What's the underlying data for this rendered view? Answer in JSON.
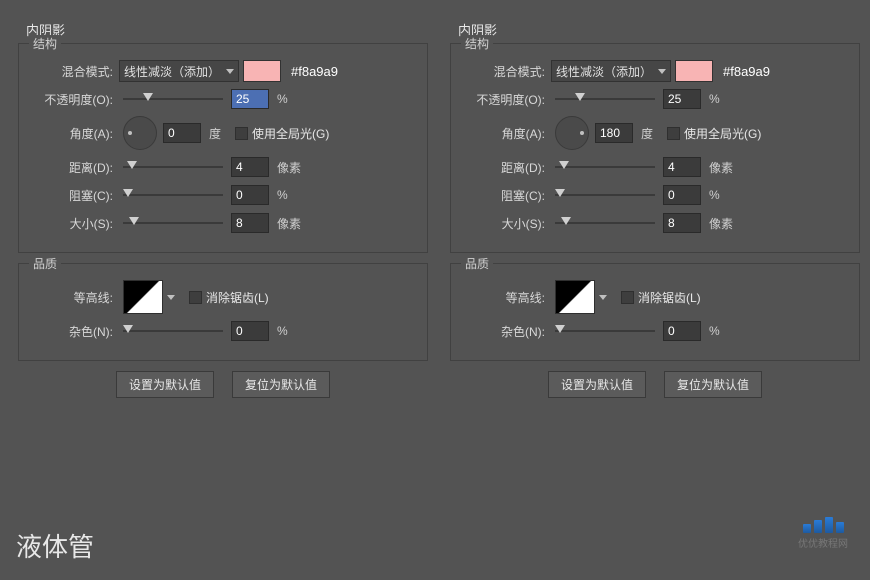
{
  "panels": [
    {
      "title": "内阴影",
      "structure": "结构",
      "quality": "品质",
      "blendLabel": "混合模式:",
      "blendValue": "线性减淡（添加）",
      "swatch": "#f8b4b4",
      "hex": "#f8a9a9",
      "opacityLabel": "不透明度(O):",
      "opacityHi": true,
      "opacityVal": "25",
      "opacityUnit": "%",
      "angleLabel": "角度(A):",
      "angleVal": "0",
      "angleUnit": "度",
      "angleDotPos": "left",
      "globalLabel": "使用全局光(G)",
      "distanceLabel": "距离(D):",
      "distanceVal": "4",
      "distanceUnit": "像素",
      "chokeLabel": "阻塞(C):",
      "chokeVal": "0",
      "chokeUnit": "%",
      "sizeLabel": "大小(S):",
      "sizeVal": "8",
      "sizeUnit": "像素",
      "contourLabel": "等高线:",
      "antiLabel": "消除锯齿(L)",
      "noiseLabel": "杂色(N):",
      "noiseVal": "0",
      "noiseUnit": "%",
      "btnDefault": "设置为默认值",
      "btnReset": "复位为默认值"
    },
    {
      "title": "内阴影",
      "structure": "结构",
      "quality": "品质",
      "blendLabel": "混合模式:",
      "blendValue": "线性减淡（添加）",
      "swatch": "#f8b4b4",
      "hex": "#f8a9a9",
      "opacityLabel": "不透明度(O):",
      "opacityHi": false,
      "opacityVal": "25",
      "opacityUnit": "%",
      "angleLabel": "角度(A):",
      "angleVal": "180",
      "angleUnit": "度",
      "angleDotPos": "right",
      "globalLabel": "使用全局光(G)",
      "distanceLabel": "距离(D):",
      "distanceVal": "4",
      "distanceUnit": "像素",
      "chokeLabel": "阻塞(C):",
      "chokeVal": "0",
      "chokeUnit": "%",
      "sizeLabel": "大小(S):",
      "sizeVal": "8",
      "sizeUnit": "像素",
      "contourLabel": "等高线:",
      "antiLabel": "消除锯齿(L)",
      "noiseLabel": "杂色(N):",
      "noiseVal": "0",
      "noiseUnit": "%",
      "btnDefault": "设置为默认值",
      "btnReset": "复位为默认值"
    }
  ],
  "footer": "液体管",
  "watermark": "优优教程网"
}
